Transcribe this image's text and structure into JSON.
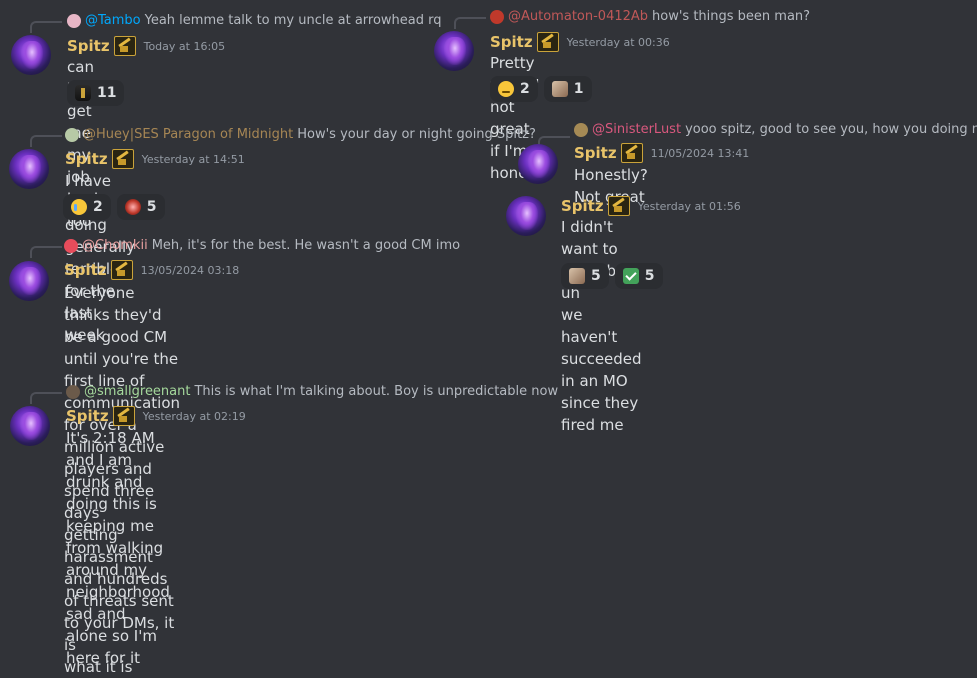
{
  "messages": [
    {
      "reply": {
        "name": "@Tambo",
        "name_color": "#00a8fc",
        "text": "Yeah lemme talk to my uncle at arrowhead rq",
        "avatar_color": "#e7b6c6"
      },
      "username": "Spitz",
      "timestamp": "Today at 16:05",
      "lines": [
        "can he get me my job back too"
      ],
      "reactions": [
        {
          "emoji": "figure",
          "count": "11"
        }
      ]
    },
    {
      "reply": {
        "name": "@Automaton-0412Ab",
        "name_color": "#c05858",
        "text": "how's things been man?",
        "avatar_color": "#c0392b"
      },
      "username": "Spitz",
      "timestamp": "Yesterday at 00:36",
      "lines": [
        "Pretty fuckin' not great if I'm honest"
      ],
      "reactions": [
        {
          "emoji": "face",
          "count": "2"
        },
        {
          "emoji": "portrait",
          "count": "1"
        }
      ]
    },
    {
      "reply": {
        "name": "@Huey|SES Paragon of Midnight",
        "name_color": "#a68654",
        "text": "How's your day or night going Spitz?",
        "avatar_color": "#b7c9a6"
      },
      "username": "Spitz",
      "timestamp": "Yesterday at 14:51",
      "lines": [
        "I have been doing generally terrible for the last week"
      ],
      "reactions": [
        {
          "emoji": "cry",
          "count": "2"
        },
        {
          "emoji": "fire",
          "count": "5"
        }
      ]
    },
    {
      "reply": {
        "name": "@SinisterLust",
        "name_color": "#d9587e",
        "text": "yooo spitz, good to see you, how you doing man?",
        "avatar_color": "#a58a55"
      },
      "username": "Spitz",
      "timestamp": "11/05/2024 13:41",
      "lines": [
        "Honestly? Not great"
      ],
      "reactions": []
    },
    {
      "reply": null,
      "username": "Spitz",
      "timestamp": "Yesterday at 01:56",
      "lines": [
        "I didn't want to say it but uh",
        "we haven't succeeded in an MO since they fired me"
      ],
      "reactions": [
        {
          "emoji": "portrait",
          "count": "5"
        },
        {
          "emoji": "check",
          "count": "5"
        }
      ]
    },
    {
      "reply": {
        "name": "@Chomkii",
        "name_color": "#e8a0a0",
        "text": "Meh, it's for the best. He wasn't a good CM imo",
        "avatar_color": "#e74c5b"
      },
      "username": "Spitz",
      "timestamp": "13/05/2024 03:18",
      "lines": [
        "Everyone thinks they'd be a good CM until you're the first line of",
        "communication for over a million active players and spend three days",
        "getting harassment and hundreds of threats sent to your DMs, it is",
        "what it is"
      ],
      "reactions": []
    },
    {
      "reply": {
        "name": "@smallgreenant",
        "name_color": "#a5d99c",
        "text": "This is what I'm talking about. Boy is unpredictable now",
        "avatar_color": "#6b5a4a"
      },
      "username": "Spitz",
      "timestamp": "Yesterday at 02:19",
      "lines": [
        "It's 2:18 AM and I am drunk and doing this is keeping me from walking",
        "around my neighborhood sad and alone so I'm here for it"
      ],
      "reactions": []
    }
  ]
}
